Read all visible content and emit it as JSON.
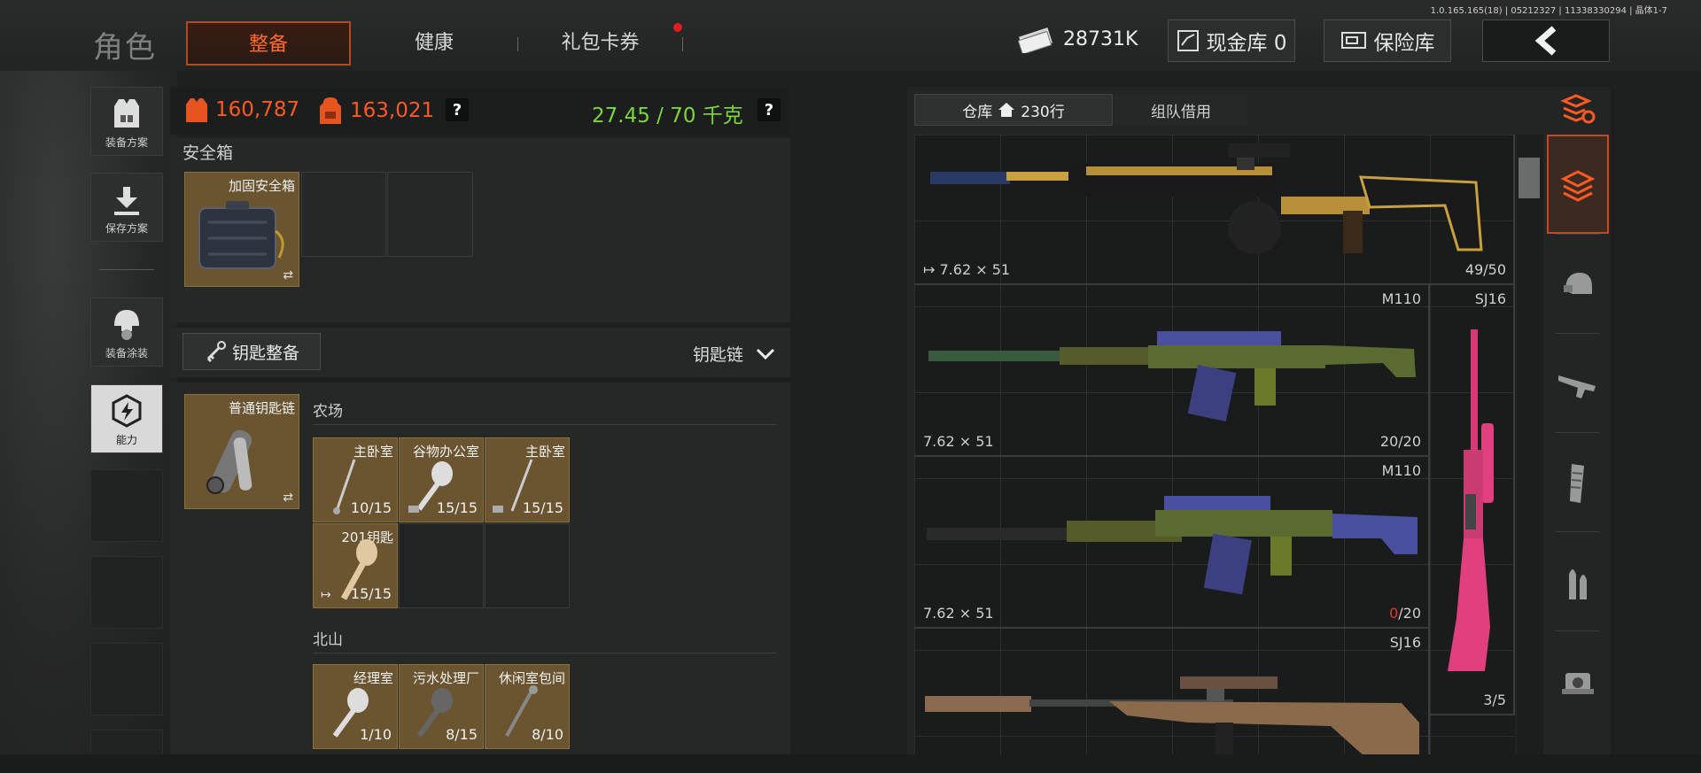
{
  "header": {
    "title": "角色",
    "tabs": [
      {
        "label": "整备",
        "active": true
      },
      {
        "label": "健康"
      },
      {
        "label": "礼包卡券",
        "notify": true
      }
    ],
    "version": "1.0.165.165(18) | 05212327 | 11338330294 | 晶体1-7",
    "cash": "28731K",
    "cash_storage_label": "现金库 0",
    "safe_label": "保险库",
    "back_label": "back"
  },
  "sidebar": [
    {
      "label": "装备方案",
      "icon": "vest-icon"
    },
    {
      "label": "保存方案",
      "icon": "download-icon"
    },
    {
      "label": "装备涂装",
      "icon": "helmet-icon"
    },
    {
      "label": "能力",
      "icon": "ability-icon",
      "active": true
    }
  ],
  "stats": {
    "armor_value": "160,787",
    "pack_value": "163,021",
    "help": "?",
    "weight": "27.45 / 70 千克"
  },
  "safebox": {
    "section_label": "安全箱",
    "item_name": "加固安全箱"
  },
  "keys": {
    "button_label": "钥匙整备",
    "dropdown_label": "钥匙链",
    "chain_name": "普通钥匙链",
    "groups": [
      {
        "name": "农场",
        "items": [
          {
            "name": "主卧室",
            "count": "10/15"
          },
          {
            "name": "谷物办公室",
            "count": "15/15"
          },
          {
            "name": "主卧室",
            "count": "15/15"
          },
          {
            "name": "201钥匙",
            "count": "15/15"
          }
        ]
      },
      {
        "name": "北山",
        "items": [
          {
            "name": "经理室",
            "count": "1/10"
          },
          {
            "name": "污水处理厂",
            "count": "8/15"
          },
          {
            "name": "休闲室包间",
            "count": "8/10"
          }
        ]
      }
    ]
  },
  "warehouse": {
    "tab_label": "仓库",
    "rows_label": "230行",
    "team_tab": "组队借用",
    "items": [
      {
        "name": "",
        "caliber": "7.62 × 51",
        "count": "49/50"
      },
      {
        "name": "M110",
        "caliber": "7.62 × 51",
        "count": "20/20"
      },
      {
        "name": "M110",
        "caliber": "7.62 × 51",
        "count_red": "0",
        "count": "/20"
      },
      {
        "name": "SJ16",
        "caliber": "",
        "count": ""
      }
    ],
    "side_item": {
      "name": "SJ16",
      "count": "3/5"
    }
  },
  "right_tabs": [
    "sort-icon",
    "layers-icon",
    "helmet-icon",
    "rifle-icon",
    "magazine-icon",
    "ammo-icon",
    "scope-icon"
  ]
}
